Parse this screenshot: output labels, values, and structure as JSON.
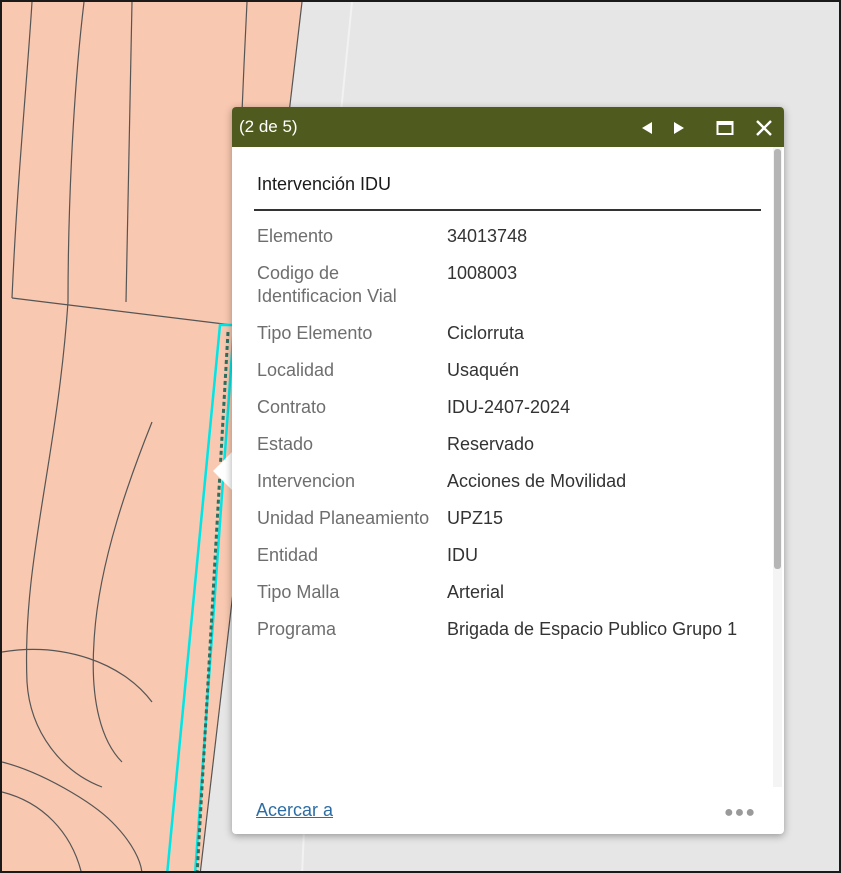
{
  "popup": {
    "counter": "(2 de 5)",
    "title": "Intervención IDU",
    "attributes": [
      {
        "label": "Elemento",
        "value": "34013748"
      },
      {
        "label": "Codigo de Identificacion Vial",
        "value": "1008003"
      },
      {
        "label": "Tipo Elemento",
        "value": "Ciclorruta"
      },
      {
        "label": "Localidad",
        "value": "Usaquén"
      },
      {
        "label": "Contrato",
        "value": "IDU-2407-2024"
      },
      {
        "label": "Estado",
        "value": "Reservado"
      },
      {
        "label": "Intervencion",
        "value": "Acciones de Movilidad"
      },
      {
        "label": "Unidad Planeamiento",
        "value": "UPZ15"
      },
      {
        "label": "Entidad",
        "value": "IDU"
      },
      {
        "label": "Tipo Malla",
        "value": "Arterial"
      },
      {
        "label": "Programa",
        "value": "Brigada de Espacio Publico Grupo 1"
      }
    ],
    "zoom_link": "Acercar a",
    "more_icon": "more-ellipsis-icon",
    "nav_icons": [
      "prev-arrow-icon",
      "next-arrow-icon",
      "maximize-icon",
      "close-icon"
    ]
  },
  "colors": {
    "header": "#4f5a1e",
    "parcel_fill": "#f8c8b0",
    "parcel_lines": "#555555",
    "highlight": "#00e5e5",
    "map_background": "#e6e6e6",
    "link": "#2e6da4"
  }
}
